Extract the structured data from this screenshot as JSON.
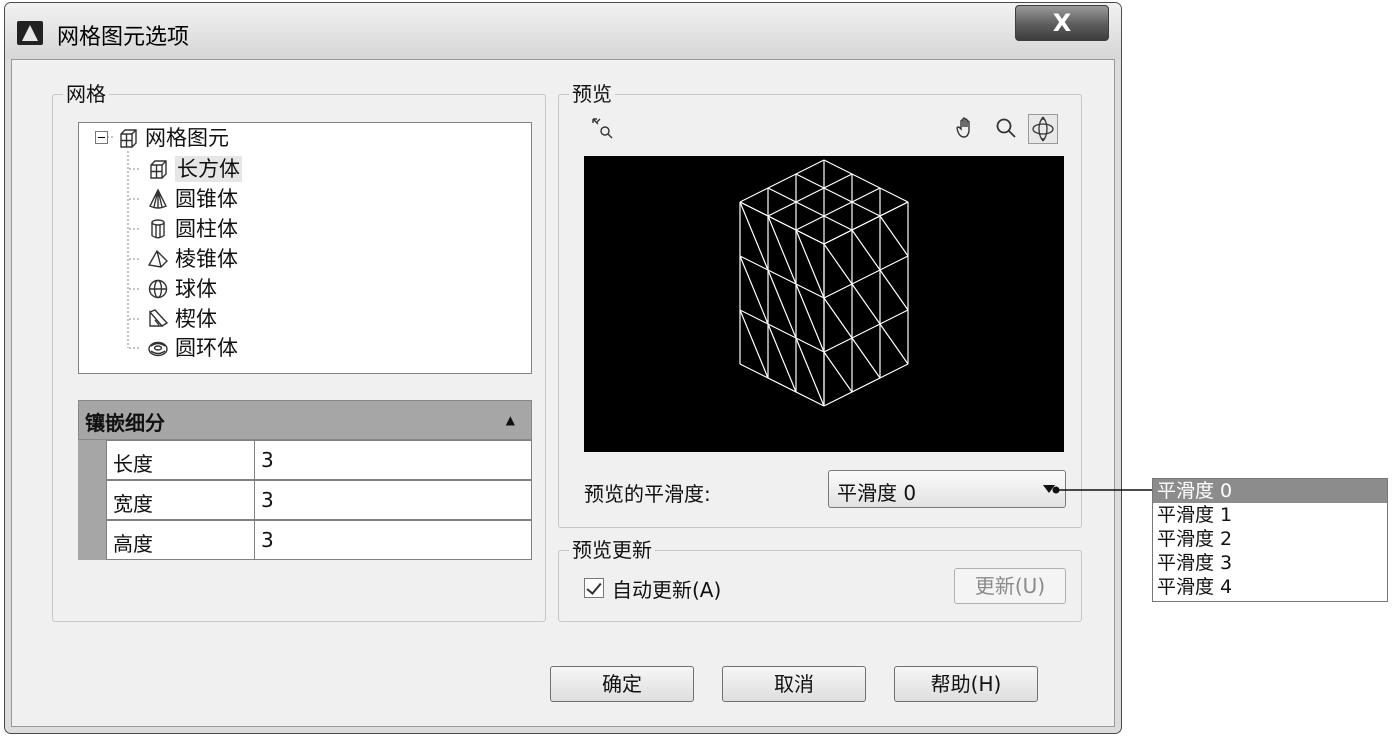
{
  "window": {
    "title": "网格图元选项",
    "close_label": "X"
  },
  "mesh_group": {
    "label": "网格",
    "tree": {
      "root": "网格图元",
      "items": [
        "长方体",
        "圆锥体",
        "圆柱体",
        "棱锥体",
        "球体",
        "楔体",
        "圆环体"
      ],
      "selected_index": 0
    },
    "tessellation": {
      "header": "镶嵌细分",
      "rows": [
        {
          "name": "长度",
          "value": "3"
        },
        {
          "name": "宽度",
          "value": "3"
        },
        {
          "name": "高度",
          "value": "3"
        }
      ]
    }
  },
  "preview_group": {
    "label": "预览",
    "smoothness_label": "预览的平滑度:",
    "smoothness_value": "平滑度 0"
  },
  "update_group": {
    "label": "预览更新",
    "auto_update_label": "自动更新(A)",
    "auto_update_checked": true,
    "update_button": "更新(U)"
  },
  "buttons": {
    "ok": "确定",
    "cancel": "取消",
    "help": "帮助(H)"
  },
  "dropdown_options": [
    "平滑度 0",
    "平滑度 1",
    "平滑度 2",
    "平滑度 3",
    "平滑度 4"
  ],
  "dropdown_selected_index": 0,
  "icons": [
    "app-logo-icon",
    "zoom-extents-icon",
    "pan-hand-icon",
    "zoom-icon",
    "orbit-icon",
    "box-icon",
    "cone-icon",
    "cylinder-icon",
    "pyramid-icon",
    "sphere-icon",
    "wedge-icon",
    "torus-icon"
  ]
}
